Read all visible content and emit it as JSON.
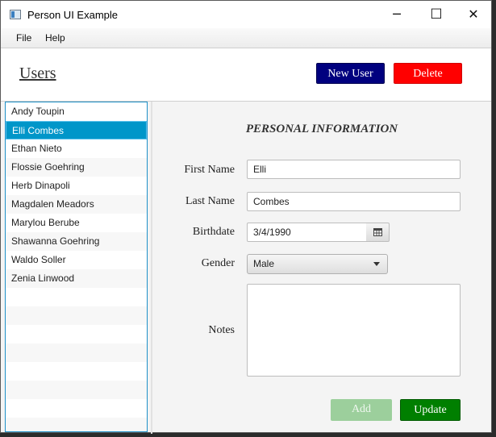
{
  "window": {
    "title": "Person UI Example",
    "controls": {
      "minimize": "─",
      "maximize": "☐",
      "close": "✕"
    }
  },
  "menu": {
    "items": [
      "File",
      "Help"
    ]
  },
  "header": {
    "title": "Users",
    "new_user_label": "New User",
    "delete_label": "Delete"
  },
  "users": {
    "items": [
      "Andy Toupin",
      "Elli Combes",
      "Ethan Nieto",
      "Flossie Goehring",
      "Herb Dinapoli",
      "Magdalen Meadors",
      "Marylou Berube",
      "Shawanna Goehring",
      "Waldo Soller",
      "Zenia Linwood"
    ],
    "selected_index": 1
  },
  "form": {
    "section_title": "PERSONAL INFORMATION",
    "first_name_label": "First Name",
    "first_name_value": "Elli",
    "last_name_label": "Last Name",
    "last_name_value": "Combes",
    "birthdate_label": "Birthdate",
    "birthdate_value": "3/4/1990",
    "gender_label": "Gender",
    "gender_value": "Male",
    "notes_label": "Notes",
    "notes_value": "",
    "add_label": "Add",
    "update_label": "Update"
  },
  "colors": {
    "new_user_button": "#00007f",
    "delete_button": "#ff0000",
    "update_button": "#007f00",
    "add_button_disabled": "#9ccf9c",
    "selection": "#0096c9"
  },
  "icons": {
    "app": "app-window-icon",
    "calendar": "calendar-icon",
    "dropdown": "chevron-down-icon"
  }
}
